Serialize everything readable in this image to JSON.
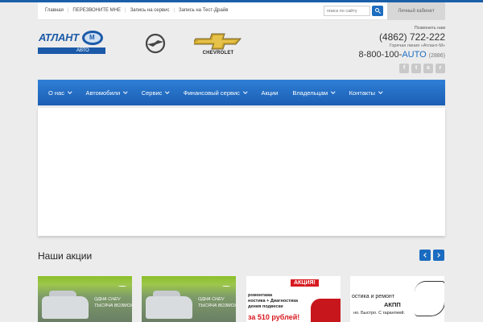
{
  "colors": {
    "accent": "#1b6cc0",
    "nav": "#2377cc",
    "sale": "#d71920",
    "background": "#ececec"
  },
  "topbar": {
    "links": [
      "Главная",
      "ПЕРЕЗВОНИТЕ МНЕ",
      "Запись на сервис",
      "Запись на Тест-Драйв"
    ],
    "search_placeholder": "поиск по сайту",
    "cabinet_label": "Личный кабинет"
  },
  "header": {
    "logo_text": "АТЛАНТ",
    "logo_letter": "М",
    "logo_sub": "АВТО",
    "brand_opel": "opel-logo",
    "brand_chevrolet": "CHEVROLET",
    "call_label": "Позвонить нам",
    "phone_main": "(4862) 722-222",
    "hotline_label": "Горячая линия «Атлант-М»",
    "phone_hotline_prefix": "8-800-100-",
    "phone_hotline_auto": "AUTO",
    "phone_hotline_code": "(2886)",
    "socials": [
      "f",
      "t",
      "s",
      "r"
    ]
  },
  "nav": {
    "items": [
      {
        "label": "О нас"
      },
      {
        "label": "Автомобили"
      },
      {
        "label": "Сервис"
      },
      {
        "label": "Финансовый сервис"
      },
      {
        "label": "Акции"
      },
      {
        "label": "Владельцам"
      },
      {
        "label": "Контакты"
      }
    ]
  },
  "promos": {
    "title": "Наши акции",
    "cards": [
      {
        "caption_line1": "ОДНА CHEV",
        "caption_line2": "ТЫСЯЧА ВОЗМОЖ"
      },
      {
        "caption_line1": "ОДНА CHEV",
        "caption_line2": "ТЫСЯЧА ВОЗМОЖ"
      },
      {
        "badge": "АКЦИЯ!",
        "line1": "ромонтажа",
        "line2": "ностика      + Диагностика",
        "line3": "дения         подвески",
        "price": "за 510 рублей!"
      },
      {
        "title1": "остика и ремонт",
        "title2": "АКПП",
        "tag": "но. Быстро. С гарантией."
      }
    ]
  }
}
